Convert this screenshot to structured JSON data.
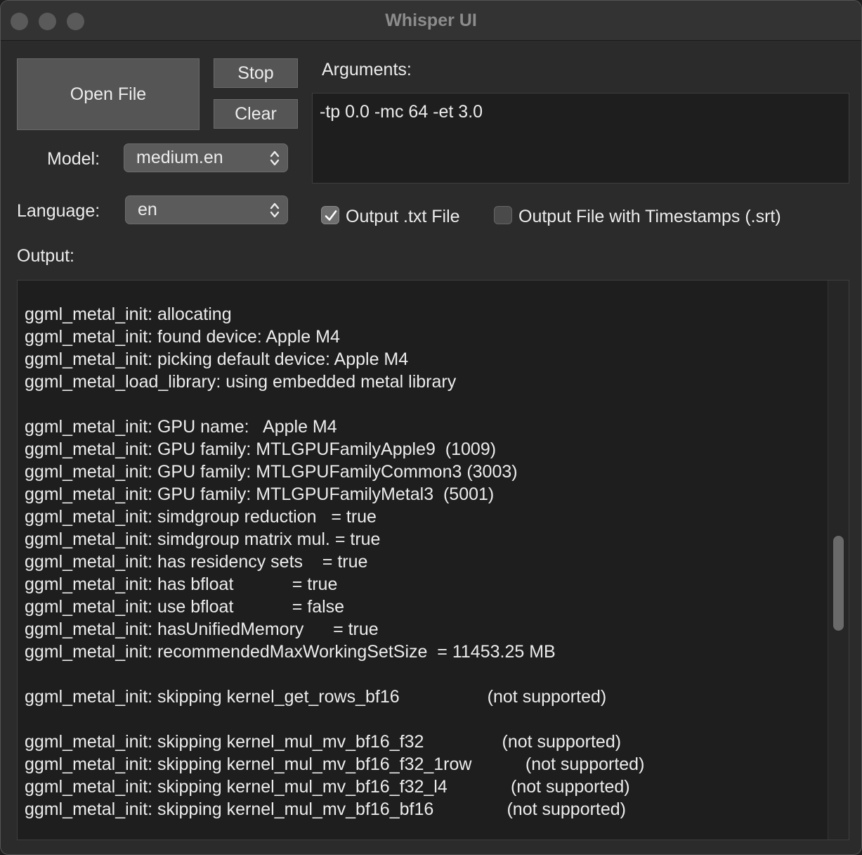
{
  "window": {
    "title": "Whisper UI"
  },
  "buttons": {
    "open_file": "Open File",
    "stop": "Stop",
    "clear": "Clear"
  },
  "model": {
    "label": "Model:",
    "value": "medium.en"
  },
  "language": {
    "label": "Language:",
    "value": "en"
  },
  "arguments": {
    "label": "Arguments:",
    "value": "-tp 0.0 -mc 64 -et 3.0"
  },
  "options": {
    "output_txt": {
      "label": "Output .txt File",
      "checked": true
    },
    "output_srt": {
      "label": "Output File with Timestamps (.srt)",
      "checked": false
    }
  },
  "output": {
    "label": "Output:",
    "lines": [
      "ggml_metal_init: allocating",
      "ggml_metal_init: found device: Apple M4",
      "ggml_metal_init: picking default device: Apple M4",
      "ggml_metal_load_library: using embedded metal library",
      "",
      "ggml_metal_init: GPU name:   Apple M4",
      "ggml_metal_init: GPU family: MTLGPUFamilyApple9  (1009)",
      "ggml_metal_init: GPU family: MTLGPUFamilyCommon3 (3003)",
      "ggml_metal_init: GPU family: MTLGPUFamilyMetal3  (5001)",
      "ggml_metal_init: simdgroup reduction   = true",
      "ggml_metal_init: simdgroup matrix mul. = true",
      "ggml_metal_init: has residency sets    = true",
      "ggml_metal_init: has bfloat            = true",
      "ggml_metal_init: use bfloat            = false",
      "ggml_metal_init: hasUnifiedMemory      = true",
      "ggml_metal_init: recommendedMaxWorkingSetSize  = 11453.25 MB",
      "",
      "ggml_metal_init: skipping kernel_get_rows_bf16                  (not supported)",
      "",
      "ggml_metal_init: skipping kernel_mul_mv_bf16_f32                (not supported)",
      "ggml_metal_init: skipping kernel_mul_mv_bf16_f32_1row           (not supported)",
      "ggml_metal_init: skipping kernel_mul_mv_bf16_f32_l4             (not supported)",
      "ggml_metal_init: skipping kernel_mul_mv_bf16_bf16               (not supported)"
    ],
    "scroll_fraction": 0.55,
    "visible_fraction": 0.17
  },
  "colors": {
    "window_bg": "#2b2b2b",
    "text": "#ececec",
    "title_text": "#8c8c8c",
    "field_bg": "#1e1e1e",
    "button_bg": "#555555"
  }
}
